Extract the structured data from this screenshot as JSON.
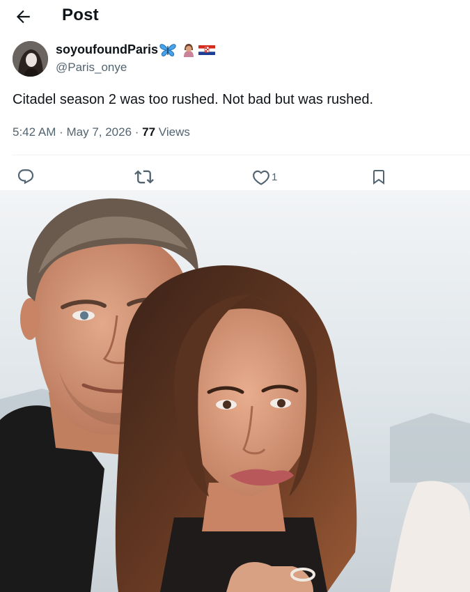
{
  "header": {
    "title": "Post",
    "back_icon": "arrow-left-icon"
  },
  "author": {
    "display_name": "soyoufoundParis",
    "emojis": [
      "butterfly-icon",
      "woman-gesturing-icon",
      "croatia-flag-icon"
    ],
    "handle": "@Paris_onye"
  },
  "tweet": {
    "text": "Citadel season 2 was too rushed. Not bad but was rushed."
  },
  "meta": {
    "time": "5:42 AM",
    "sep1": " · ",
    "date": "May 7, 2026",
    "sep2": " · ",
    "views_count": "77",
    "views_label": " Views"
  },
  "actions": {
    "reply_icon": "reply-icon",
    "repost_icon": "repost-icon",
    "like_icon": "heart-icon",
    "like_count": "1",
    "bookmark_icon": "bookmark-icon"
  },
  "media": {
    "type": "photo"
  },
  "colors": {
    "text": "#0f1419",
    "secondary": "#536471",
    "divider": "#eff3f4"
  }
}
